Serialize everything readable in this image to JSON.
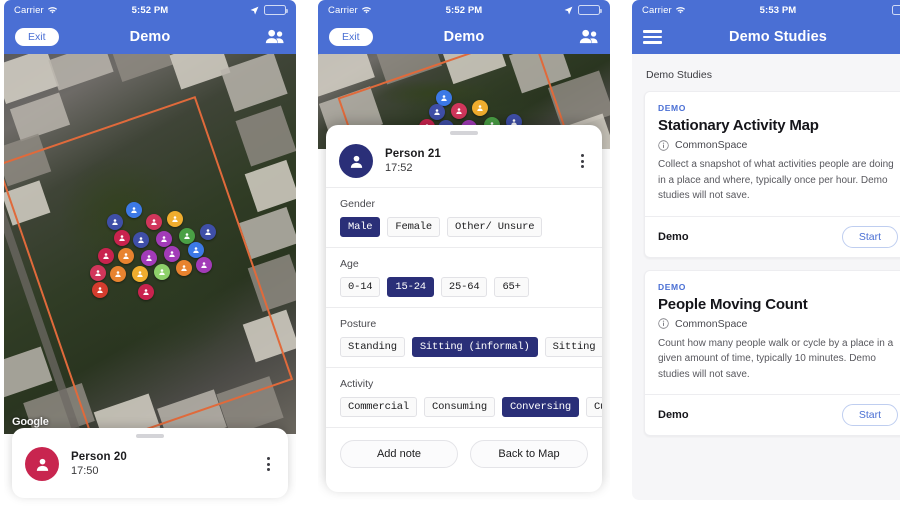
{
  "colors": {
    "brand_blue": "#4a6fd4",
    "selected_navy": "#2a2f78",
    "avatar_red": "#c8254f",
    "park_outline_orange": "#e06a3b",
    "tag_blue": "#4a6fd4"
  },
  "panel1": {
    "status": {
      "carrier": "Carrier",
      "time": "5:52 PM",
      "wifi_icon": "wifi-icon",
      "location_icon": "location-arrow-icon",
      "battery_icon": "battery-icon"
    },
    "nav": {
      "exit_label": "Exit",
      "title": "Demo",
      "right_icon": "people-icon"
    },
    "map": {
      "attribution": "Google",
      "marker_icon": "person-pin-icon"
    },
    "sheet": {
      "avatar_icon": "person-avatar-icon",
      "person_name": "Person 20",
      "person_time": "17:50",
      "menu_icon": "kebab-menu-icon",
      "grabber": "drag-handle"
    }
  },
  "panel2": {
    "status": {
      "carrier": "Carrier",
      "time": "5:52 PM",
      "wifi_icon": "wifi-icon",
      "location_icon": "location-arrow-icon",
      "battery_icon": "battery-icon"
    },
    "nav": {
      "exit_label": "Exit",
      "title": "Demo",
      "right_icon": "people-icon"
    },
    "header": {
      "avatar_icon": "person-avatar-icon",
      "person_name": "Person 21",
      "person_time": "17:52",
      "menu_icon": "kebab-menu-icon"
    },
    "fields": [
      {
        "label": "Gender",
        "options": [
          "Male",
          "Female",
          "Other/ Unsure"
        ],
        "selected": "Male"
      },
      {
        "label": "Age",
        "options": [
          "0-14",
          "15-24",
          "25-64",
          "65+"
        ],
        "selected": "15-24"
      },
      {
        "label": "Posture",
        "options": [
          "Standing",
          "Sitting (informal)",
          "Sitting (formal)"
        ],
        "selected": "Sitting (informal)"
      },
      {
        "label": "Activity",
        "options": [
          "Commercial",
          "Consuming",
          "Conversing",
          "Cultural"
        ],
        "selected": "Conversing"
      }
    ],
    "actions": {
      "add_note": "Add note",
      "back_to_map": "Back to Map"
    }
  },
  "panel3": {
    "status": {
      "carrier": "Carrier",
      "time": "5:53 PM",
      "wifi_icon": "wifi-icon",
      "battery_icon": "battery-icon"
    },
    "nav": {
      "menu_icon": "hamburger-menu-icon",
      "title": "Demo Studies"
    },
    "section_title": "Demo Studies",
    "cards": [
      {
        "tag": "DEMO",
        "title": "Stationary Activity Map",
        "author": "CommonSpace",
        "author_icon": "info-circle-icon",
        "description": "Collect a snapshot of what activities people are doing in a place and where, typically once per hour. Demo studies will not save.",
        "footer_label": "Demo",
        "start_label": "Start"
      },
      {
        "tag": "DEMO",
        "title": "People Moving Count",
        "author": "CommonSpace",
        "author_icon": "info-circle-icon",
        "description": "Count how many people walk or cycle by a place in a given amount of time, typically 10 minutes. Demo studies will not save.",
        "footer_label": "Demo",
        "start_label": "Start"
      }
    ]
  }
}
